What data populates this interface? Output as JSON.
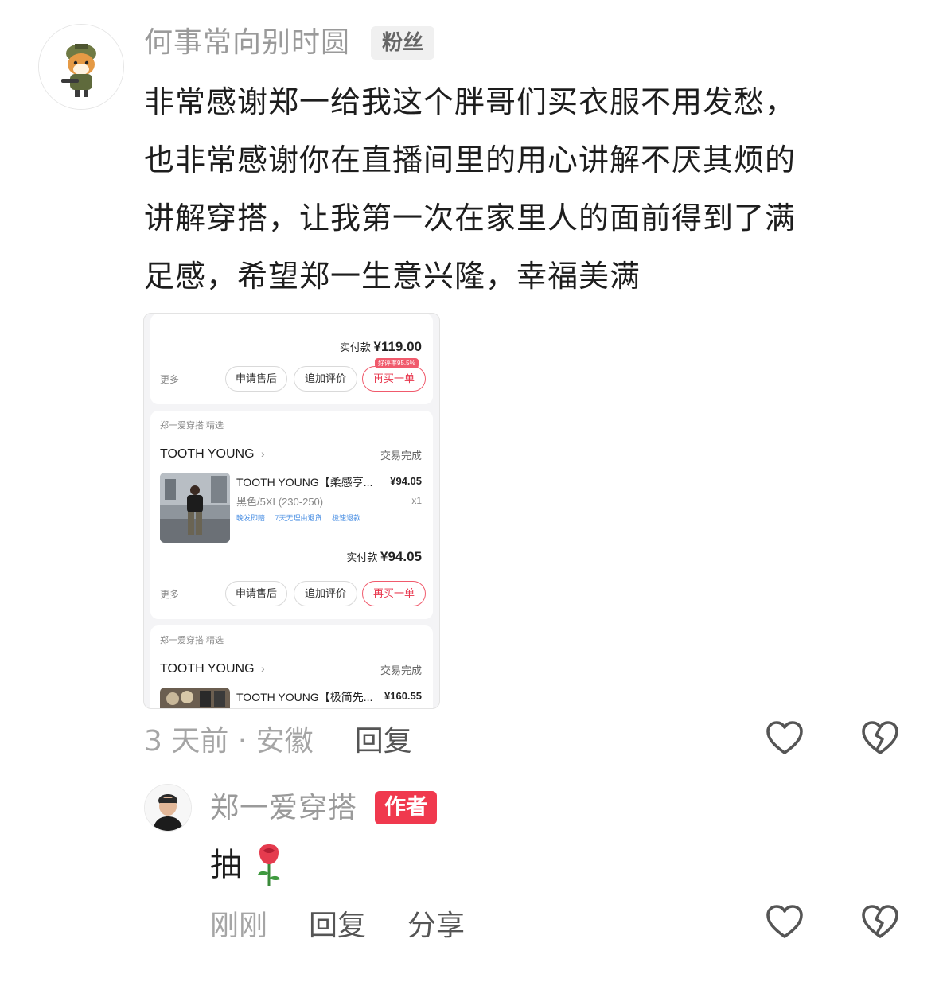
{
  "comment": {
    "username": "何事常向别时圆",
    "badge": "粉丝",
    "lines": [
      "非常感谢郑一给我这个胖哥们买衣服不用发愁，",
      "也非常感谢你在直播间里的用心讲解不厌其烦的",
      "讲解穿搭，让我第一次在家里人的面前得到了满",
      "足感，希望郑一生意兴隆，幸福美满"
    ],
    "time_location": "3 天前 · 安徽",
    "reply_label": "回复"
  },
  "screenshot": {
    "order1": {
      "amount_label": "实付款",
      "amount": "¥119.00",
      "more": "更多",
      "btn_aftersale": "申请售后",
      "btn_review": "追加评价",
      "btn_rebuy": "再买一单",
      "rating_tag": "好评率95.5%"
    },
    "order2": {
      "shop_tag": "郑一爱穿搭 精选",
      "store": "TOOTH YOUNG",
      "status": "交易完成",
      "product_title": "TOOTH YOUNG【柔感亨...",
      "price": "¥94.05",
      "spec": "黑色/5XL(230-250)",
      "qty": "x1",
      "tags": [
        "晚发即赔",
        "7天无理由退货",
        "极速退款"
      ],
      "amount_label": "实付款",
      "amount": "¥94.05",
      "more": "更多",
      "btn_aftersale": "申请售后",
      "btn_review": "追加评价",
      "btn_rebuy": "再买一单"
    },
    "order3": {
      "shop_tag": "郑一爱穿搭 精选",
      "store": "TOOTH YOUNG",
      "status": "交易完成",
      "product_title": "TOOTH YOUNG【极简先...",
      "price": "¥160.55"
    }
  },
  "reply": {
    "username": "郑一爱穿搭",
    "badge": "作者",
    "text": "抽",
    "emoji": "🌹",
    "time": "刚刚",
    "reply_label": "回复",
    "share_label": "分享"
  },
  "colors": {
    "accent_red": "#f0394e",
    "muted_text": "#9a9a9a",
    "link_blue": "#4a8fe3"
  },
  "icons": [
    "heart-outline-icon",
    "broken-heart-icon",
    "chevron-right-icon",
    "rose-emoji-icon"
  ]
}
